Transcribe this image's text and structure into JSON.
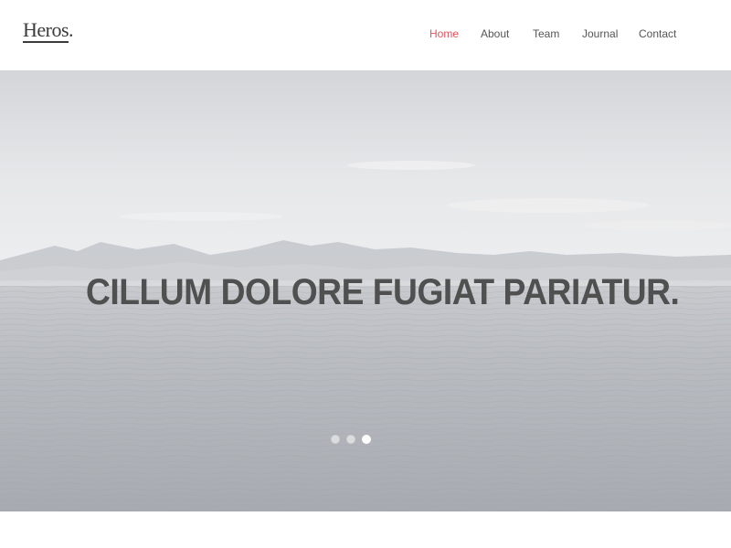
{
  "header": {
    "logo": "Heros.",
    "nav": [
      {
        "label": "Home",
        "active": true
      },
      {
        "label": "About",
        "active": false
      },
      {
        "label": "Team",
        "active": false
      },
      {
        "label": "Journal",
        "active": false
      },
      {
        "label": "Contact",
        "active": false
      }
    ]
  },
  "hero": {
    "title": "CILLUM DOLORE FUGIAT PARIATUR.",
    "slides": 3,
    "active_slide": 3
  },
  "colors": {
    "accent": "#e8505b",
    "text": "#505050",
    "nav_text": "#555555"
  }
}
